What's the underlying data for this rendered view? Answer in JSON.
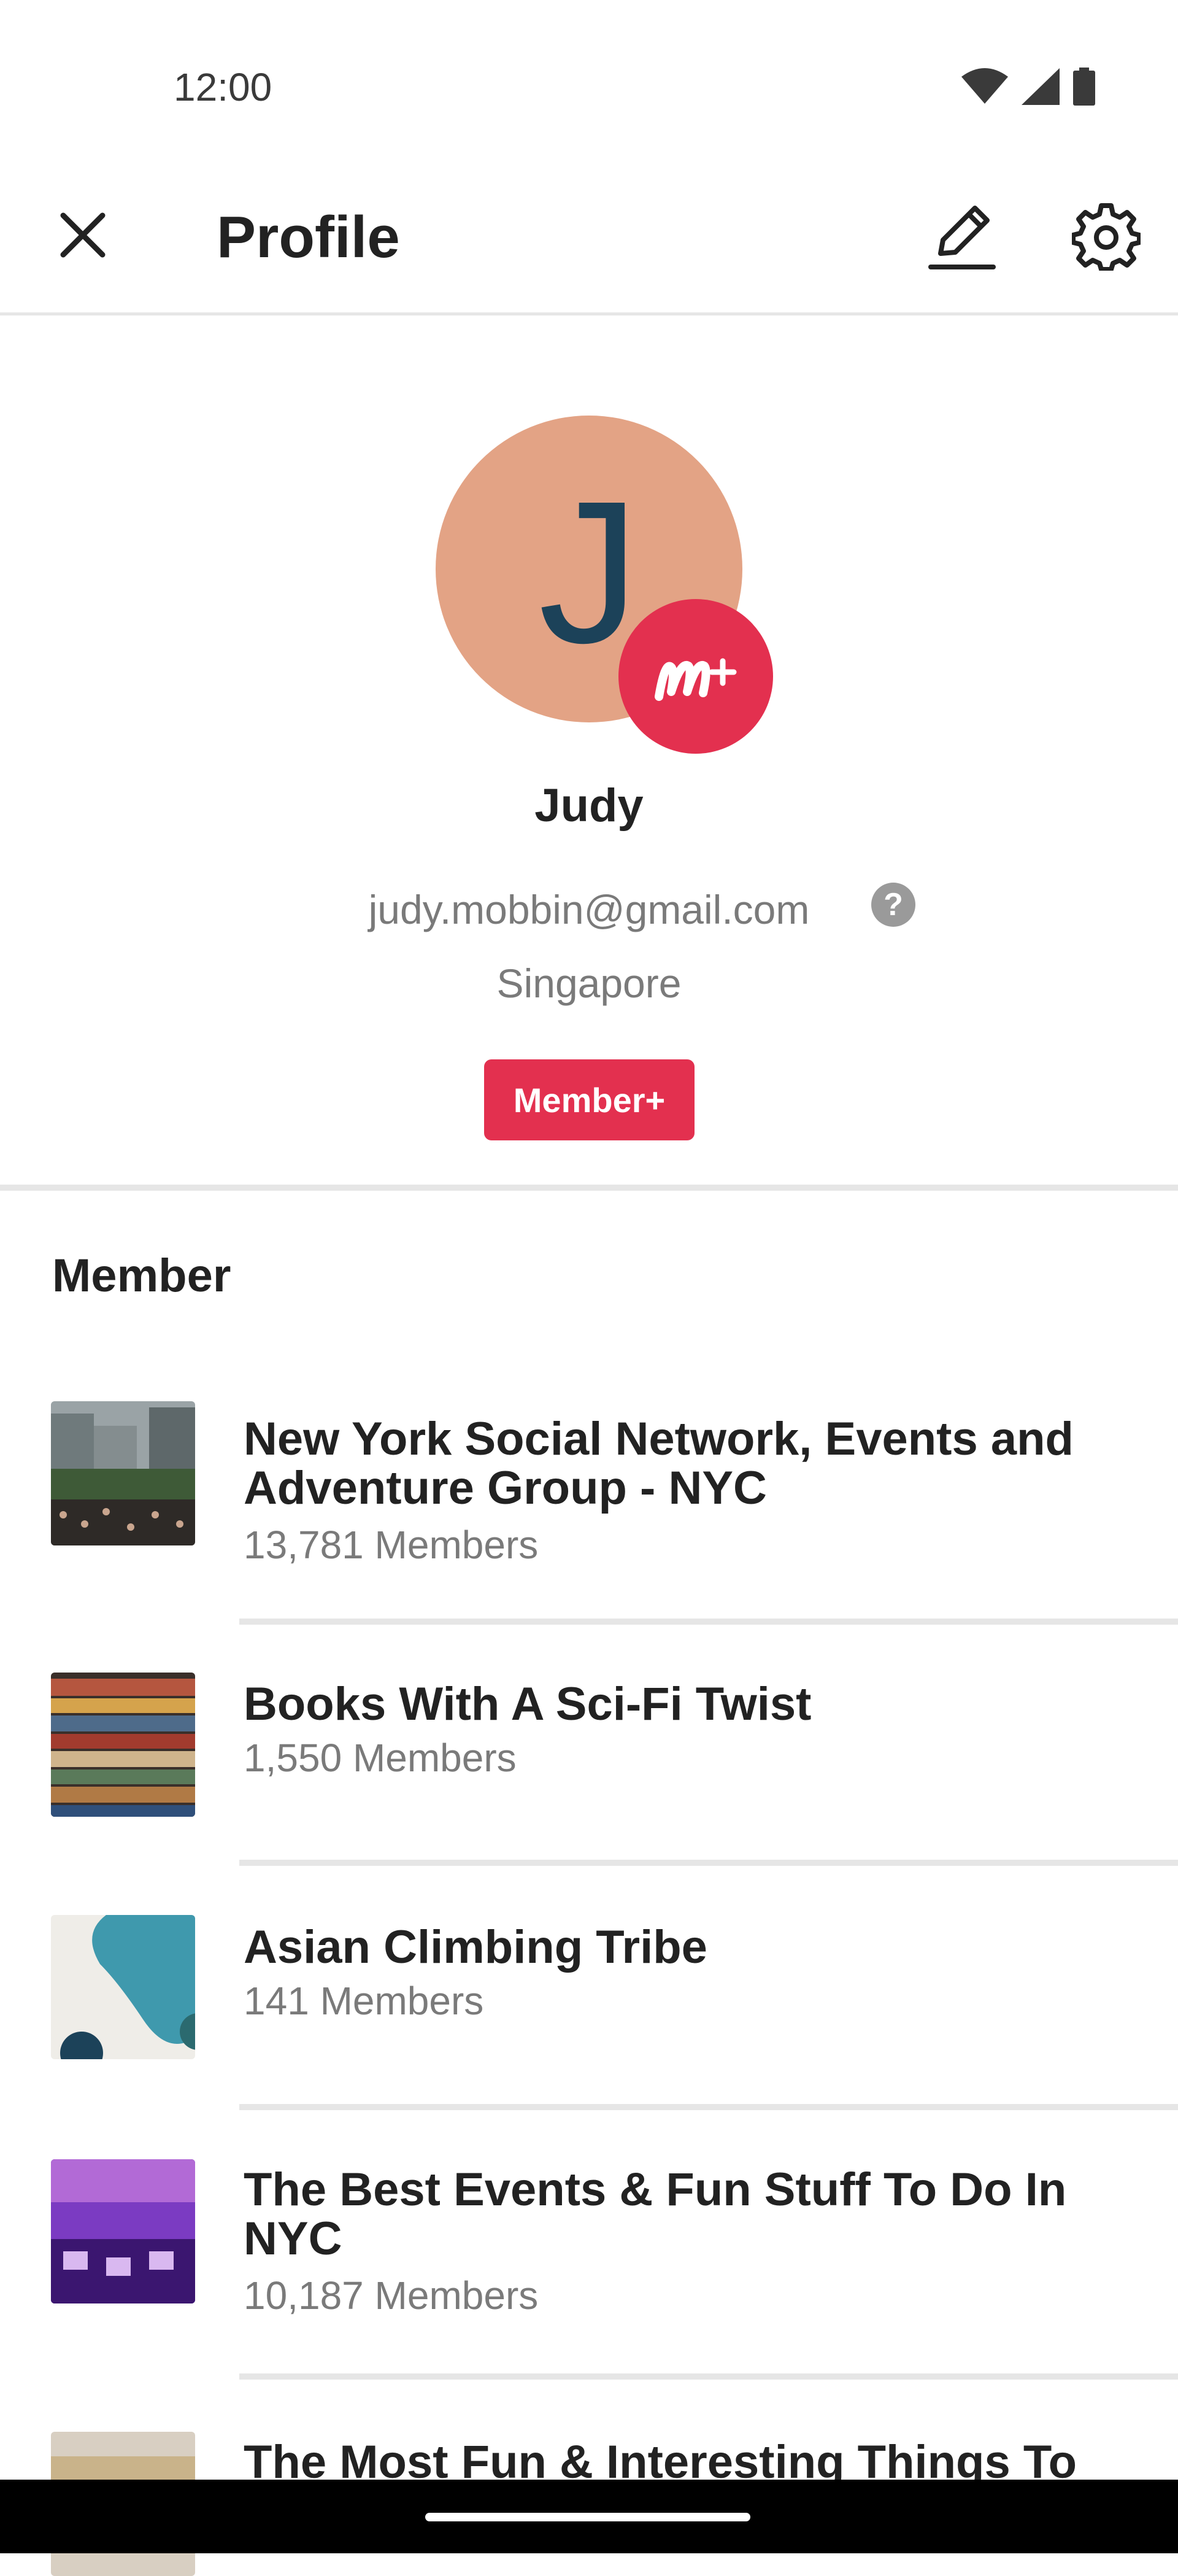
{
  "status_bar": {
    "time": "12:00",
    "icons": [
      "wifi-icon",
      "signal-icon",
      "battery-icon"
    ]
  },
  "app_bar": {
    "title": "Profile",
    "close_icon": "close-icon",
    "edit_icon": "edit-icon",
    "settings_icon": "gear-icon"
  },
  "profile": {
    "initial": "J",
    "avatar_color": "#e3a385",
    "initial_color": "#1c4259",
    "badge_icon": "member-plus-icon",
    "badge_color": "#e3304f",
    "name": "Judy",
    "email": "judy.mobbin@gmail.com",
    "help_icon": "?",
    "location": "Singapore",
    "membership_badge": "Member+"
  },
  "section": {
    "heading": "Member"
  },
  "groups": [
    {
      "title": "New York Social Network, Events and Adventure Group - NYC",
      "count": "13,781 Members"
    },
    {
      "title": "Books With A Sci-Fi Twist",
      "count": "1,550 Members"
    },
    {
      "title": "Asian Climbing Tribe",
      "count": "141 Members"
    },
    {
      "title": "The Best Events & Fun Stuff To Do In NYC",
      "count": "10,187 Members"
    },
    {
      "title": "The Most Fun & Interesting Things To",
      "count": ""
    }
  ]
}
